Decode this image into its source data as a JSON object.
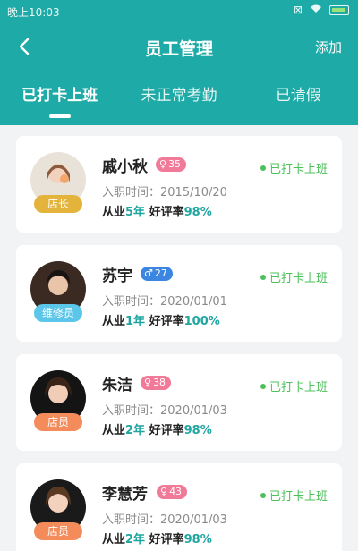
{
  "statusbar": {
    "time": "晚上10:03"
  },
  "navbar": {
    "title": "员工管理",
    "add_label": "添加"
  },
  "tabs": [
    {
      "label": "已打卡上班",
      "active": true
    },
    {
      "label": "未正常考勤",
      "active": false
    },
    {
      "label": "已请假",
      "active": false
    }
  ],
  "employees": [
    {
      "name": "戚小秋",
      "gender": "female",
      "gender_icon": "female-icon",
      "age": "35",
      "role": "店长",
      "joined_label": "入职时间：",
      "joined_date": "2015/10/20",
      "years_prefix": "从业",
      "years": "5年",
      "rating_label": "好评率",
      "rating": "98%",
      "status": "已打卡上班"
    },
    {
      "name": "苏宇",
      "gender": "male",
      "gender_icon": "male-icon",
      "age": "27",
      "role": "维修员",
      "joined_label": "入职时间：",
      "joined_date": "2020/01/01",
      "years_prefix": "从业",
      "years": "1年",
      "rating_label": "好评率",
      "rating": "100%",
      "status": "已打卡上班"
    },
    {
      "name": "朱洁",
      "gender": "female",
      "gender_icon": "female-icon",
      "age": "38",
      "role": "店员",
      "joined_label": "入职时间：",
      "joined_date": "2020/01/03",
      "years_prefix": "从业",
      "years": "2年",
      "rating_label": "好评率",
      "rating": "98%",
      "status": "已打卡上班"
    },
    {
      "name": "李慧芳",
      "gender": "female",
      "gender_icon": "female-icon",
      "age": "43",
      "role": "店员",
      "joined_label": "入职时间：",
      "joined_date": "2020/01/03",
      "years_prefix": "从业",
      "years": "2年",
      "rating_label": "好评率",
      "rating": "98%",
      "status": "已打卡上班"
    }
  ],
  "colors": {
    "primary": "#1eaaa6",
    "female_badge": "#f07a97",
    "male_badge": "#3a86e0",
    "status_green": "#4cc05a",
    "role_manager": "#e3b33c",
    "role_repair": "#5cc6ea",
    "role_staff": "#f38b5a"
  }
}
